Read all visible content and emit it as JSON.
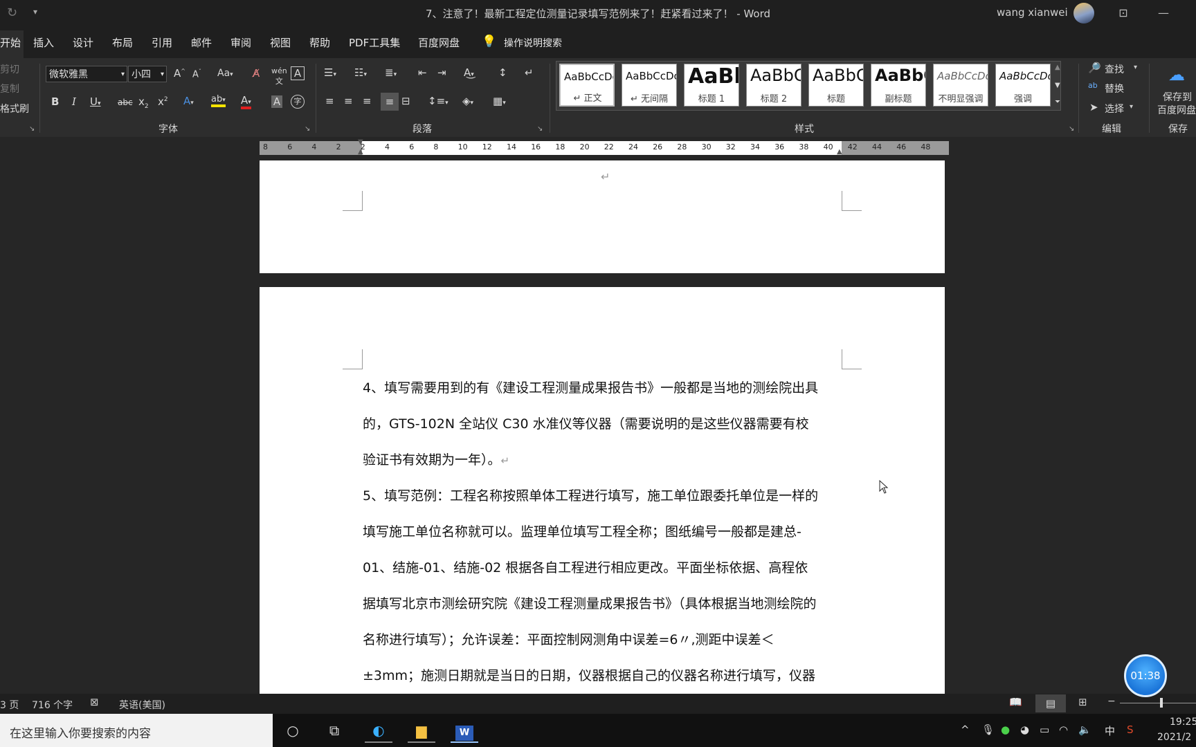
{
  "window": {
    "title": "7、注意了！最新工程定位测量记录填写范例来了！赶紧看过来了！  -  Word",
    "user": "wang xianwei"
  },
  "menu": {
    "items": [
      "开始",
      "插入",
      "设计",
      "布局",
      "引用",
      "邮件",
      "审阅",
      "视图",
      "帮助",
      "PDF工具集",
      "百度网盘"
    ],
    "search": "操作说明搜索"
  },
  "ribbon": {
    "clipboard": {
      "cut": "剪切",
      "copy": "复制",
      "format_painter": "格式刷"
    },
    "font": {
      "name": "微软雅黑",
      "size": "小四",
      "label": "字体",
      "case": "Aa"
    },
    "paragraph": {
      "label": "段落"
    },
    "styles": {
      "label": "样式",
      "items": [
        {
          "sample": "AaBbCcDc",
          "name": "↵ 正文"
        },
        {
          "sample": "AaBbCcDc",
          "name": "↵ 无间隔"
        },
        {
          "sample": "AaBl",
          "name": "标题 1"
        },
        {
          "sample": "AaBbC",
          "name": "标题 2"
        },
        {
          "sample": "AaBbC",
          "name": "标题"
        },
        {
          "sample": "AaBbC",
          "name": "副标题"
        },
        {
          "sample": "AaBbCcDc",
          "name": "不明显强调"
        },
        {
          "sample": "AaBbCcDc",
          "name": "强调"
        }
      ]
    },
    "editing": {
      "find": "查找",
      "replace": "替换",
      "select": "选择",
      "label": "编辑"
    },
    "save": {
      "line1": "保存到",
      "line2": "百度网盘",
      "label": "保存"
    }
  },
  "ruler": {
    "ticks": [
      "8",
      "6",
      "4",
      "2",
      "2",
      "4",
      "6",
      "8",
      "10",
      "12",
      "14",
      "16",
      "18",
      "20",
      "22",
      "24",
      "26",
      "28",
      "30",
      "32",
      "34",
      "36",
      "38",
      "40",
      "42",
      "44",
      "46",
      "48"
    ]
  },
  "document": {
    "page1_mark": "↵",
    "lines": [
      "4、填写需要用到的有《建设工程测量成果报告书》一般都是当地的测绘院出具",
      "的，GTS-102N  全站仪 C30  水准仪等仪器（需要说明的是这些仪器需要有校",
      "验证书有效期为一年）。",
      "5、填写范例：工程名称按照单体工程进行填写，施工单位跟委托单位是一样的",
      "填写施工单位名称就可以。监理单位填写工程全称；图纸编号一般都是建总-",
      "01、结施-01、结施-02 根据各自工程进行相应更改。平面坐标依据、高程依",
      "据填写北京市测绘研究院《建设工程测量成果报告书》（具体根据当地测绘院的",
      "名称进行填写）；允许误差：平面控制网测角中误差=6〃,测距中误差＜",
      "±3mm；施测日期就是当日的日期，仪器根据自己的仪器名称进行填写，仪器"
    ],
    "return_mark": "↵"
  },
  "status": {
    "page": "3 页",
    "words": "716 个字",
    "language": "英语(美国)"
  },
  "timer": "01:38",
  "taskbar": {
    "search_placeholder": "在这里输入你要搜索的内容",
    "ime": "中",
    "time": "19:25",
    "date": "2021/2"
  }
}
